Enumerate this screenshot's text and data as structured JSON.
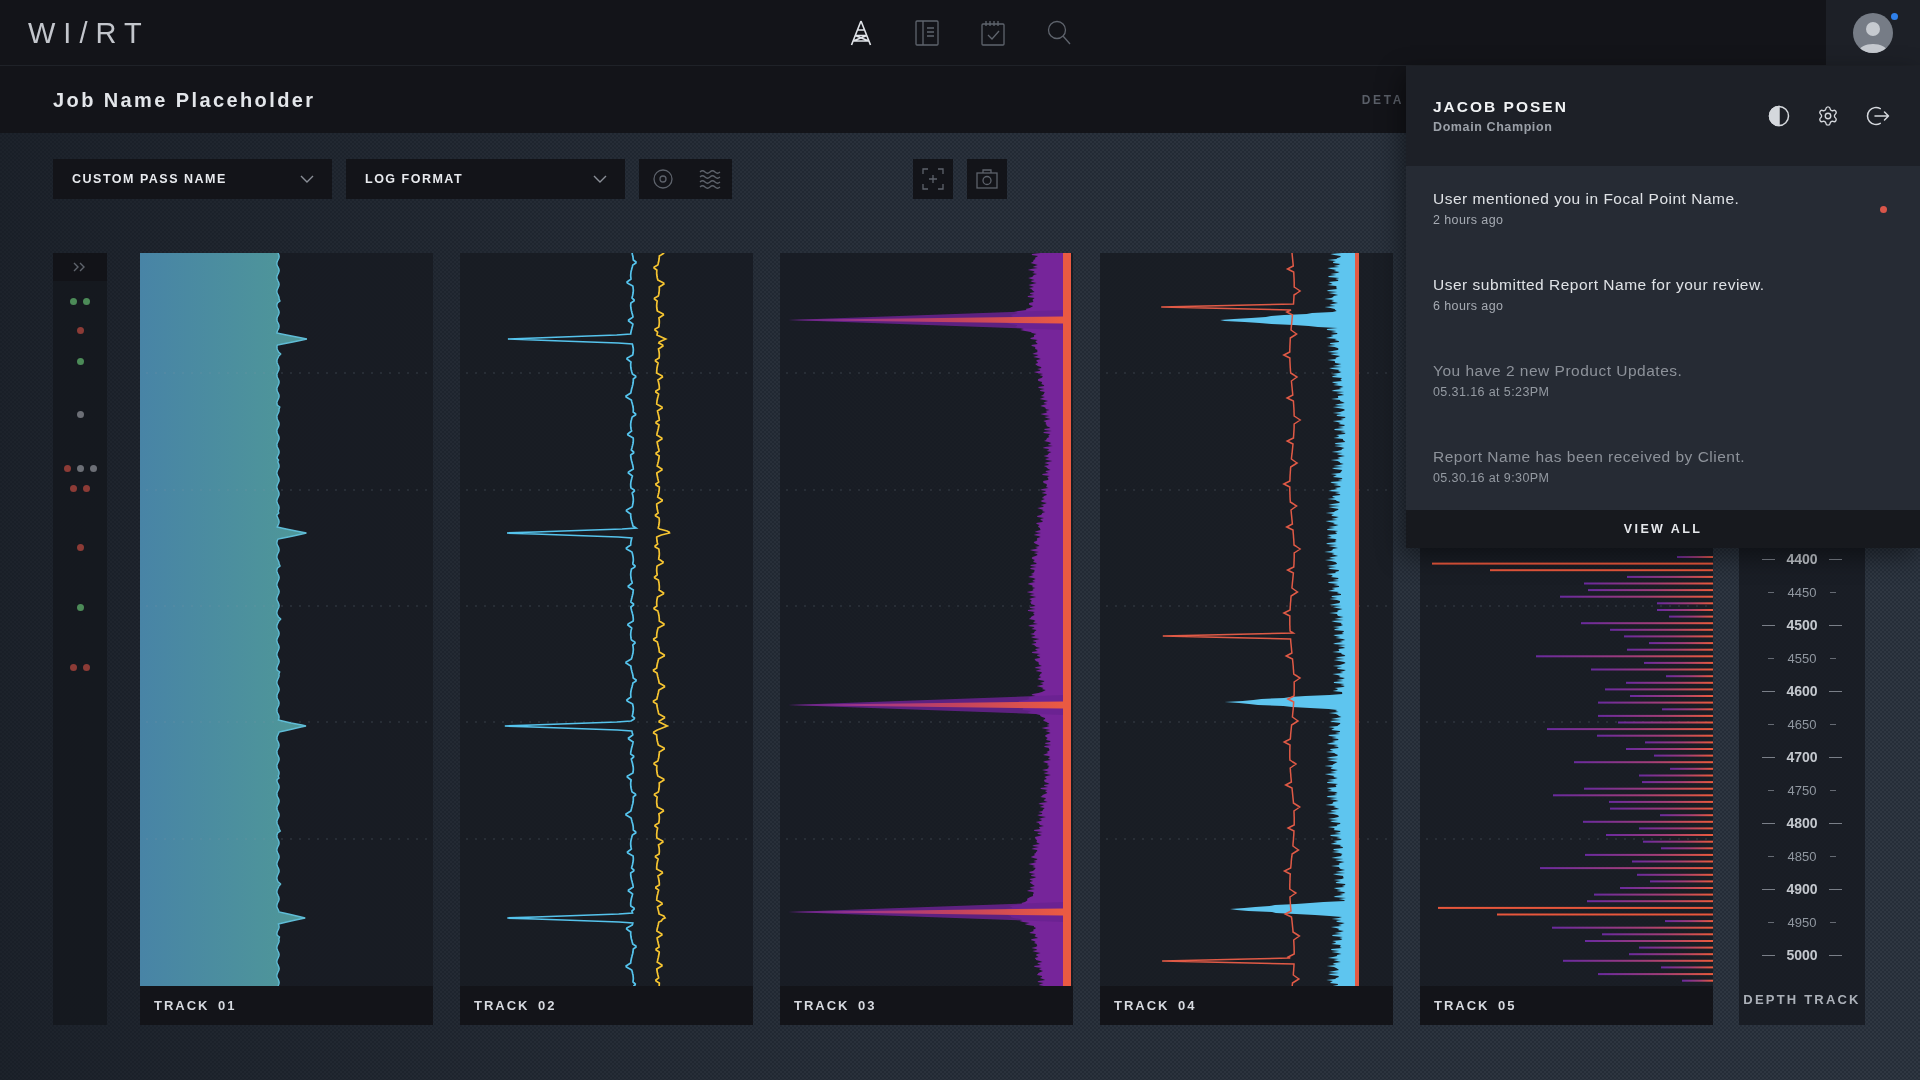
{
  "top_bar": {
    "logo": "WI/RT",
    "nav": [
      {
        "kind": "rig",
        "selected": true
      },
      {
        "kind": "document",
        "selected": false
      },
      {
        "kind": "checklist",
        "selected": false
      },
      {
        "kind": "search",
        "selected": false
      }
    ],
    "avatar": {
      "online": true
    }
  },
  "job_bar": {
    "title": "Job Name Placeholder",
    "tab": "DETA"
  },
  "toolbar": {
    "dropdowns": [
      {
        "value": "CUSTOM PASS NAME"
      },
      {
        "value": "LOG FORMAT"
      }
    ],
    "view_options": [
      {
        "kind": "target"
      },
      {
        "kind": "waves"
      }
    ],
    "actions": [
      {
        "kind": "focus"
      },
      {
        "kind": "snapshot"
      }
    ]
  },
  "marker_gutter": {
    "rows": [
      {
        "dots": [
          {
            "color": "#4c8b58"
          },
          {
            "color": "#4c8b58"
          }
        ]
      },
      {
        "dots": [
          {
            "color": "#8c3b36"
          }
        ]
      },
      {
        "dots": [
          {
            "color": "#4c8b58"
          }
        ]
      },
      {
        "dots": [
          {
            "color": "#6c6f76"
          }
        ]
      },
      {
        "dots": [
          {
            "color": "#8c3b36"
          },
          {
            "color": "#6c6f76"
          },
          {
            "color": "#6c6f76"
          }
        ]
      },
      {
        "dots": [
          {
            "color": "#8c3b36"
          },
          {
            "color": "#8c3b36"
          }
        ]
      },
      {
        "dots": [
          {
            "color": "#8c3b36"
          }
        ]
      },
      {
        "dots": [
          {
            "color": "#4c8b58"
          }
        ]
      },
      {
        "dots": [
          {
            "color": "#8c3b36"
          },
          {
            "color": "#8c3b36"
          }
        ]
      }
    ]
  },
  "tracks": [
    {
      "label": "TRACK 01",
      "kind": "fill"
    },
    {
      "label": "TRACK 02",
      "kind": "dual-line"
    },
    {
      "label": "TRACK 03",
      "kind": "spectrum"
    },
    {
      "label": "TRACK 04",
      "kind": "line-fill"
    },
    {
      "label": "TRACK 05",
      "kind": "bars"
    }
  ],
  "depth_track": {
    "ticks": [
      {
        "label": "4400",
        "kind": "major"
      },
      {
        "label": "4450",
        "kind": "minor"
      },
      {
        "label": "4500",
        "kind": "major"
      },
      {
        "label": "4550",
        "kind": "minor"
      },
      {
        "label": "4600",
        "kind": "major"
      },
      {
        "label": "4650",
        "kind": "minor"
      },
      {
        "label": "4700",
        "kind": "major"
      },
      {
        "label": "4750",
        "kind": "minor"
      },
      {
        "label": "4800",
        "kind": "major"
      },
      {
        "label": "4850",
        "kind": "minor"
      },
      {
        "label": "4900",
        "kind": "major"
      },
      {
        "label": "4950",
        "kind": "minor"
      },
      {
        "label": "5000",
        "kind": "major"
      }
    ],
    "title": "DEPTH TRACK"
  },
  "profile_panel": {
    "name": "JACOB POSEN",
    "role": "Domain Champion",
    "actions": [
      {
        "kind": "contrast"
      },
      {
        "kind": "settings"
      },
      {
        "kind": "logout"
      }
    ],
    "notifications": [
      {
        "text": "User mentioned you in Focal Point Name.",
        "time": "2 hours ago",
        "read": false,
        "new": true
      },
      {
        "text": "User submitted Report Name for your review.",
        "time": "6 hours ago",
        "read": false,
        "new": false
      },
      {
        "text": "You have 2 new Product Updates.",
        "time": "05.31.16 at 5:23PM",
        "read": true,
        "new": false
      },
      {
        "text": "Report Name has been received by Client.",
        "time": "05.30.16 at 9:30PM",
        "read": true,
        "new": false
      }
    ],
    "footer": "VIEW ALL"
  }
}
